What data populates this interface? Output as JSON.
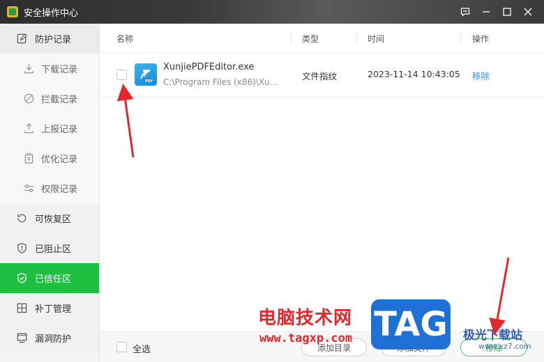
{
  "window": {
    "title": "安全操作中心"
  },
  "sidebar": {
    "items": [
      {
        "label": "防护记录",
        "icon": "edit-icon",
        "type": "top"
      },
      {
        "label": "下载记录",
        "icon": "download-icon",
        "type": "sub"
      },
      {
        "label": "拦截记录",
        "icon": "block-icon",
        "type": "sub"
      },
      {
        "label": "上报记录",
        "icon": "upload-icon",
        "type": "sub"
      },
      {
        "label": "优化记录",
        "icon": "clipboard-icon",
        "type": "sub"
      },
      {
        "label": "权限记录",
        "icon": "sliders-icon",
        "type": "sub"
      },
      {
        "label": "可恢复区",
        "icon": "restore-icon",
        "type": "sec"
      },
      {
        "label": "已阻止区",
        "icon": "shield-alert-icon",
        "type": "sec"
      },
      {
        "label": "已信任区",
        "icon": "shield-check-icon",
        "type": "active"
      },
      {
        "label": "补丁管理",
        "icon": "grid-icon",
        "type": "sec"
      },
      {
        "label": "漏洞防护",
        "icon": "monitor-icon",
        "type": "sec"
      }
    ]
  },
  "table": {
    "columns": [
      "名称",
      "类型",
      "时间",
      "操作"
    ],
    "rows": [
      {
        "name": "XunjiePDFEditor.exe",
        "path": "C:\\Program Files (x86)\\Xu...",
        "type": "文件指纹",
        "time": "2023-11-14 10:43:05",
        "action": "移除",
        "icon": "pdf-editor-icon"
      }
    ]
  },
  "footer": {
    "select_all": "全选",
    "add_folder": "添加目录",
    "add_file": "添加文件",
    "remove": "移除"
  },
  "watermark": {
    "site_name": "电脑技术网",
    "site_url": "www.tagxp.com",
    "tag": "TAG",
    "jg_name": "极光下载站",
    "jg_url": "www.xz7.com"
  },
  "colors": {
    "accent_green": "#1fbf41",
    "link_blue": "#2f8ff0",
    "annotation_red": "#e0282d"
  }
}
